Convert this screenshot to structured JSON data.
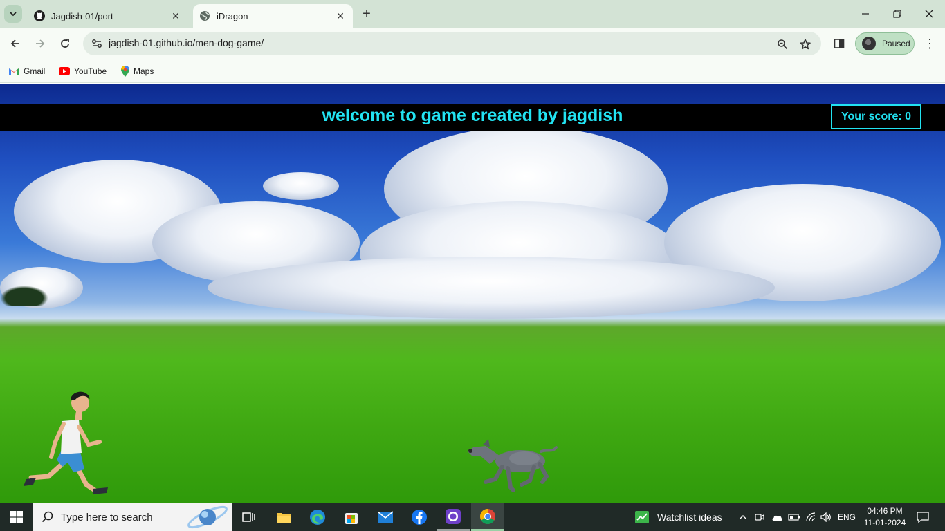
{
  "browser": {
    "tabs": [
      {
        "title": "Jagdish-01/port",
        "icon": "github-icon",
        "active": false
      },
      {
        "title": "iDragon",
        "icon": "globe-icon",
        "active": true
      }
    ],
    "url": "jagdish-01.github.io/men-dog-game/",
    "profile_label": "Paused",
    "bookmarks": [
      {
        "label": "Gmail",
        "icon": "gmail-icon"
      },
      {
        "label": "YouTube",
        "icon": "youtube-icon"
      },
      {
        "label": "Maps",
        "icon": "maps-icon"
      }
    ]
  },
  "game": {
    "title": "welcome to game created by jagdish",
    "score_text": "Your score: 0",
    "accent": "#22e3f2"
  },
  "taskbar": {
    "search_placeholder": "Type here to search",
    "widget_label": "Watchlist ideas",
    "language": "ENG",
    "time": "04:46 PM",
    "date": "11-01-2024"
  }
}
